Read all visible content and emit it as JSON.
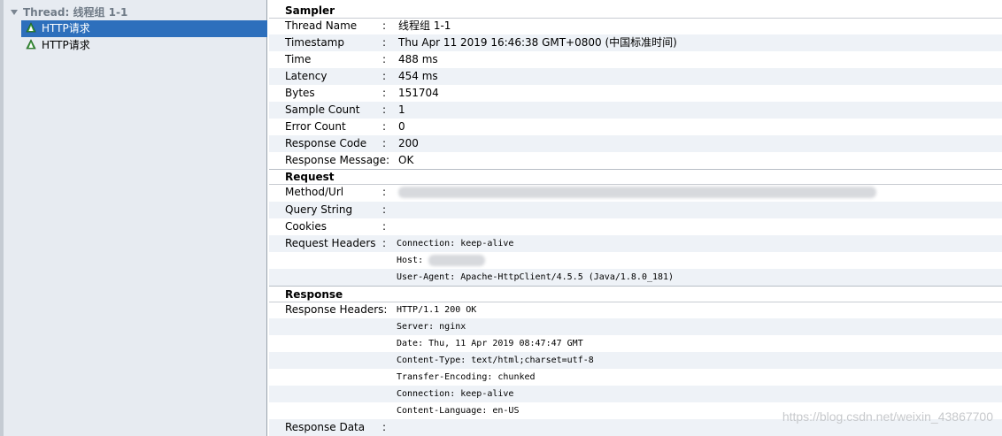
{
  "tree": {
    "root": "Thread: 线程组 1-1",
    "items": [
      {
        "label": "HTTP请求",
        "selected": true
      },
      {
        "label": "HTTP请求",
        "selected": false
      }
    ]
  },
  "sampler": {
    "title": "Sampler",
    "rows": [
      {
        "key": "Thread Name",
        "colon": ":",
        "value": "线程组 1-1"
      },
      {
        "key": "Timestamp",
        "colon": ":",
        "value": "Thu Apr 11 2019 16:46:38 GMT+0800 (中国标准时间)"
      },
      {
        "key": "Time",
        "colon": ":",
        "value": "488 ms"
      },
      {
        "key": "Latency",
        "colon": ":",
        "value": "454 ms"
      },
      {
        "key": "Bytes",
        "colon": ":",
        "value": "151704"
      },
      {
        "key": "Sample Count",
        "colon": ":",
        "value": "1"
      },
      {
        "key": "Error Count",
        "colon": ":",
        "value": "0"
      },
      {
        "key": "Response Code",
        "colon": ":",
        "value": "200"
      },
      {
        "key": "Response Message:",
        "colon": "",
        "value": "OK"
      }
    ]
  },
  "request": {
    "title": "Request",
    "rows": [
      {
        "key": "Method/Url",
        "colon": ":",
        "value": ""
      },
      {
        "key": "Query String",
        "colon": ":",
        "value": ""
      },
      {
        "key": "Cookies",
        "colon": ":",
        "value": ""
      },
      {
        "key": "Request Headers",
        "colon": ":",
        "value": "Connection: keep-alive"
      },
      {
        "key": "",
        "colon": "",
        "value": "Host:"
      },
      {
        "key": "",
        "colon": "",
        "value": "User-Agent: Apache-HttpClient/4.5.5 (Java/1.8.0_181)"
      }
    ]
  },
  "response": {
    "title": "Response",
    "rows": [
      {
        "key": "Response Headers:",
        "colon": "",
        "value": "HTTP/1.1 200 OK"
      },
      {
        "key": "",
        "colon": "",
        "value": "Server: nginx"
      },
      {
        "key": "",
        "colon": "",
        "value": "Date: Thu, 11 Apr 2019 08:47:47 GMT"
      },
      {
        "key": "",
        "colon": "",
        "value": "Content-Type: text/html;charset=utf-8"
      },
      {
        "key": "",
        "colon": "",
        "value": "Transfer-Encoding: chunked"
      },
      {
        "key": "",
        "colon": "",
        "value": "Connection: keep-alive"
      },
      {
        "key": "",
        "colon": "",
        "value": "Content-Language: en-US"
      },
      {
        "key": "Response Data",
        "colon": ":",
        "value": ""
      }
    ]
  },
  "watermark": "https://blog.csdn.net/weixin_43867700",
  "icons": {
    "tree_item": "sampler-triangle-icon",
    "expand": "triangle-down-icon"
  }
}
